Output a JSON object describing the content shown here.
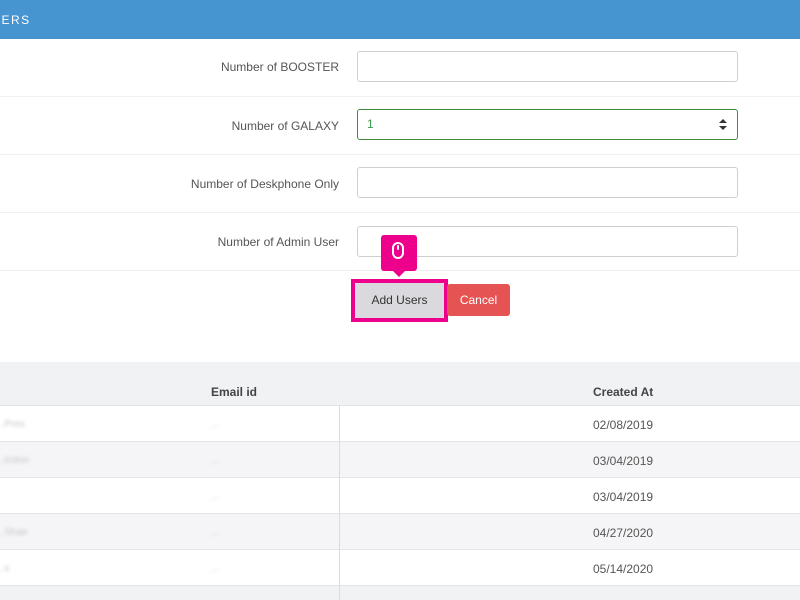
{
  "header": {
    "title": "SERS"
  },
  "form": {
    "rows": [
      {
        "label": "Number of BOOSTER",
        "value": ""
      },
      {
        "label": "Number of GALAXY",
        "value": "1"
      },
      {
        "label": "Number of Deskphone Only",
        "value": ""
      },
      {
        "label": "Number of Admin User",
        "value": ""
      }
    ],
    "add_users_label": "Add Users",
    "cancel_label": "Cancel"
  },
  "table": {
    "columns": {
      "email": "Email id",
      "created": "Created At"
    },
    "rows": [
      {
        "name": "...Pres",
        "email": "...",
        "created": "02/08/2019"
      },
      {
        "name": "...trolon",
        "email": "...",
        "created": "03/04/2019"
      },
      {
        "name": "",
        "email": "...",
        "created": "03/04/2019"
      },
      {
        "name": "...Shae",
        "email": "...",
        "created": "04/27/2020"
      },
      {
        "name": "...s",
        "email": "...",
        "created": "05/14/2020"
      }
    ]
  },
  "icons": {
    "cursor": "mouse-icon"
  },
  "colors": {
    "header": "#4694d0",
    "accent": "#ec008c",
    "cancel": "#e55353",
    "active_border": "#3f8a3f"
  }
}
